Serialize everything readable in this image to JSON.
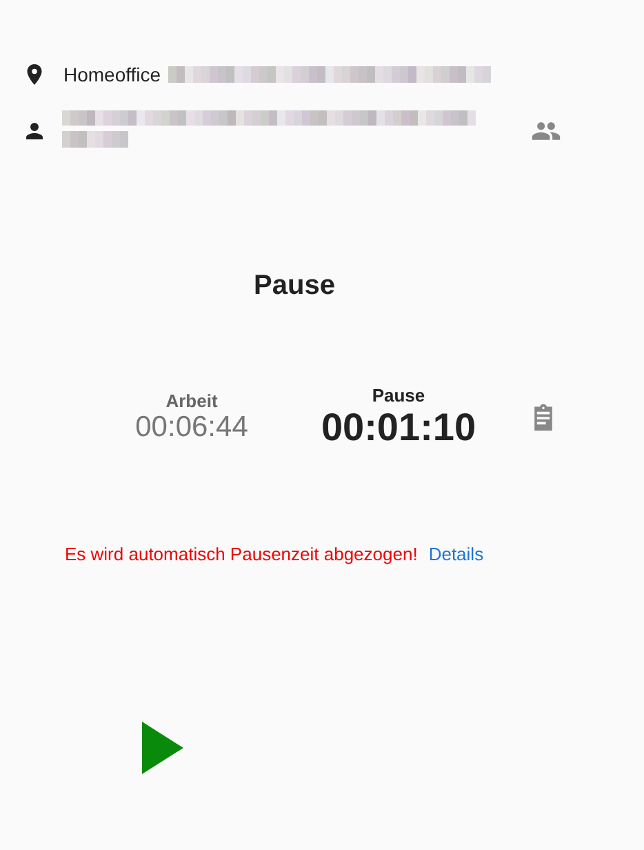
{
  "location": {
    "label": "Homeoffice"
  },
  "title": "Pause",
  "timers": [
    {
      "label": "Arbeit",
      "value": "00:06:44",
      "active": false
    },
    {
      "label": "Pause",
      "value": "00:01:10",
      "active": true
    }
  ],
  "notice": {
    "text": "Es wird automatisch Pausenzeit abgezogen!",
    "link": "Details"
  }
}
